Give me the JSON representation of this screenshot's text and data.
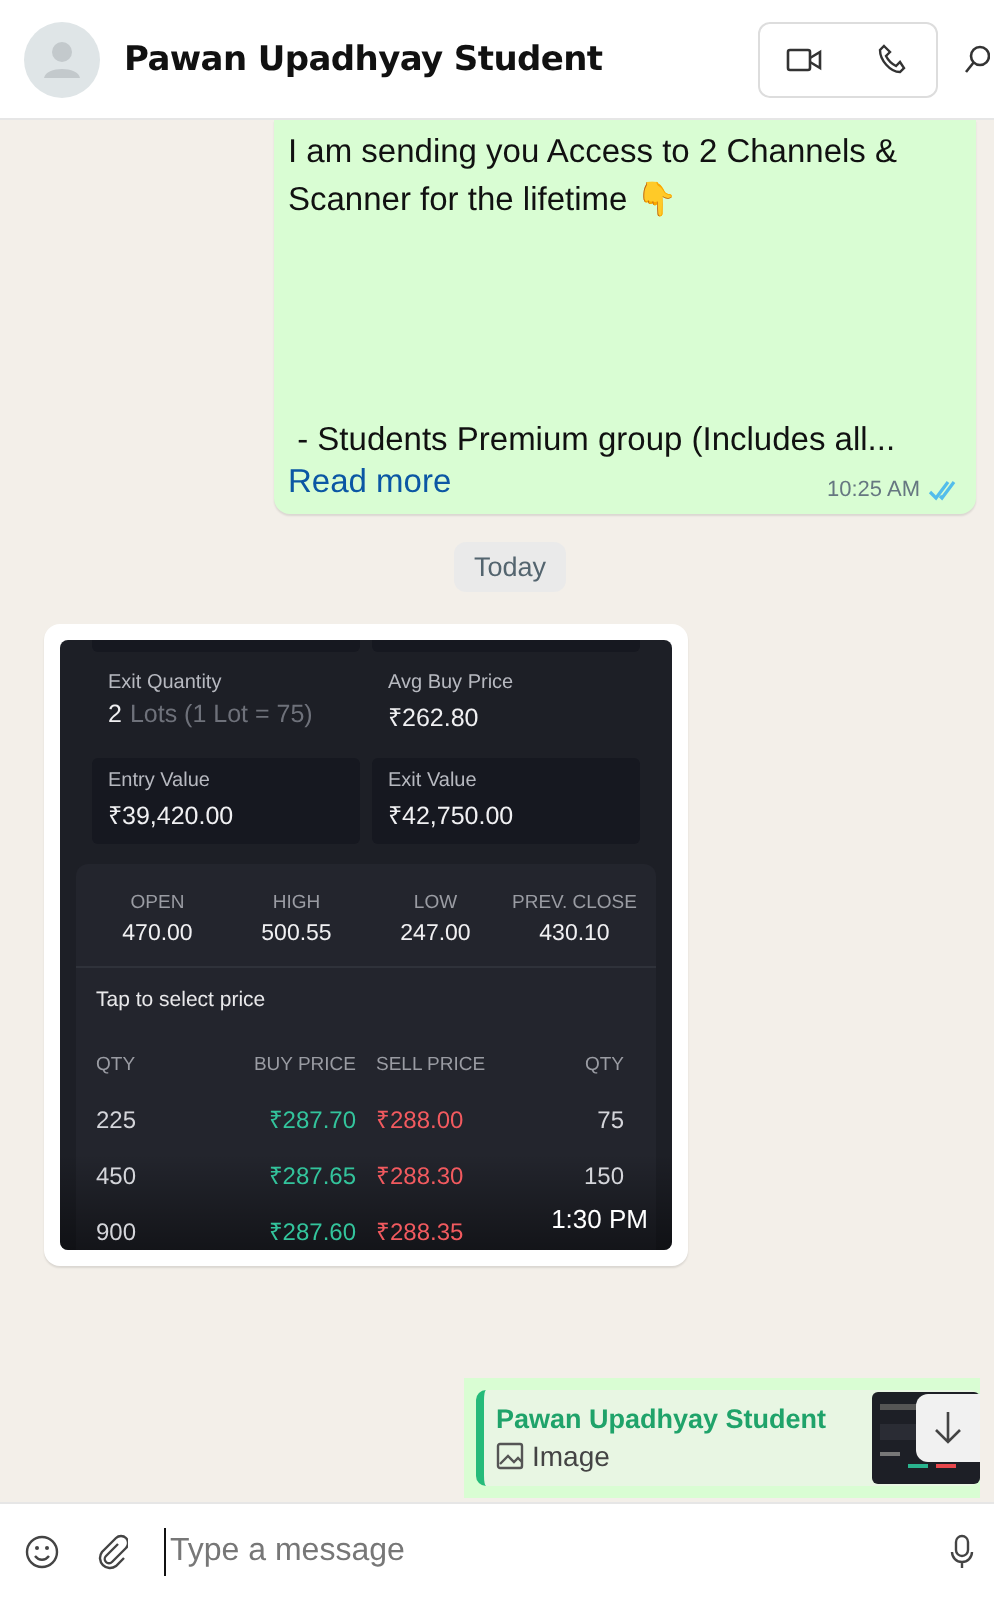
{
  "header": {
    "contact_name": "Pawan Upadhyay Student"
  },
  "messages": [
    {
      "kind": "text",
      "outgoing": true,
      "text": "I am sending you Access to 2 Channels & Scanner for the lifetime 👇\n\n\n\n\n - Students Premium group (Includes all...",
      "link": "Read more",
      "time": "10:25 AM",
      "read": true
    },
    {
      "kind": "date",
      "text": "Today"
    },
    {
      "kind": "image",
      "time": "1:30 PM",
      "screenshot": {
        "fields": [
          {
            "label": "Exit Quantity",
            "value": "2",
            "note": "Lots (1 Lot = 75)"
          },
          {
            "label": "Avg Buy Price",
            "value": "₹262.80"
          }
        ],
        "value_cards": [
          {
            "label": "Entry Value",
            "value": "₹39,420.00"
          },
          {
            "label": "Exit Value",
            "value": "₹42,750.00"
          }
        ],
        "stats": [
          {
            "label": "OPEN",
            "value": "470.00"
          },
          {
            "label": "HIGH",
            "value": "500.55"
          },
          {
            "label": "LOW",
            "value": "247.00"
          },
          {
            "label": "PREV. CLOSE",
            "value": "430.10"
          }
        ],
        "hint": "Tap to select price",
        "columns": [
          "QTY",
          "BUY PRICE",
          "SELL PRICE",
          "QTY"
        ],
        "rows": [
          {
            "buy_qty": "225",
            "buy_price": "₹287.70",
            "sell_price": "₹288.00",
            "sell_qty": "75"
          },
          {
            "buy_qty": "450",
            "buy_price": "₹287.65",
            "sell_price": "₹288.30",
            "sell_qty": "150"
          },
          {
            "buy_qty": "900",
            "buy_price": "₹287.60",
            "sell_price": "₹288.35"
          }
        ]
      }
    }
  ],
  "reply_preview": {
    "sender": "Pawan Upadhyay Student",
    "kind_label": "Image"
  },
  "composer": {
    "placeholder": "Type a message"
  }
}
